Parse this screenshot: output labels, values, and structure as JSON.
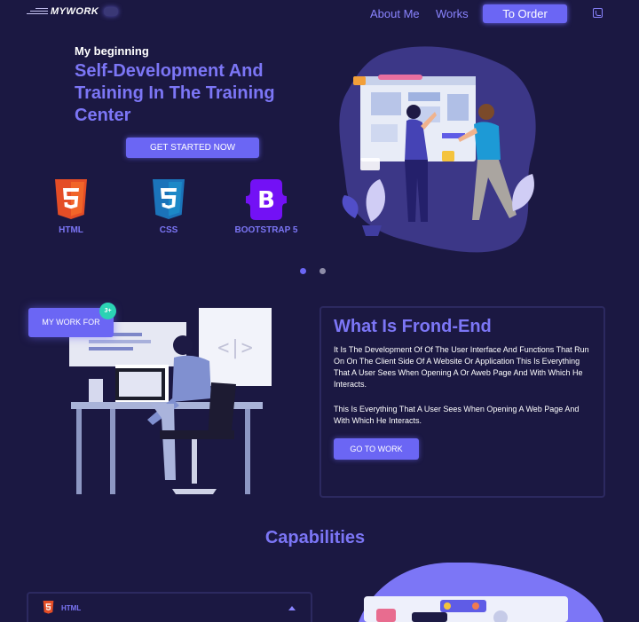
{
  "nav": {
    "logo_text": "MYWORK",
    "links": [
      "About Me",
      "Works"
    ],
    "order_label": "To Order",
    "contact_icon": "phone-icon"
  },
  "hero": {
    "subtitle": "My beginning",
    "title": "Self-Development And Training In The Training Center",
    "cta_label": "GET STARTED NOW",
    "technologies": [
      {
        "label": "HTML",
        "icon": "html5-icon",
        "color": "#e44d26"
      },
      {
        "label": "CSS",
        "icon": "css3-icon",
        "color": "#1b73ba"
      },
      {
        "label": "BOOTSTRAP 5",
        "icon": "bootstrap-icon",
        "color": "#7311f5"
      }
    ],
    "slider_dots": 2,
    "active_dot": 0
  },
  "feature": {
    "tag_label": "MY WORK FOR",
    "tag_badge": "3+",
    "title": "What Is Frond-End",
    "paragraphs": [
      "It Is The Development Of Of The User Interface And Functions That Run On On The Client Side Of A Website Or Application This Is Everything That A User Sees When Opening A Or Aweb Page And With Which He Interacts.",
      "This Is Everything That A User Sees When Opening A Web Page And With Which He Interacts."
    ],
    "button_label": "GO TO WORK"
  },
  "capabilities": {
    "title": "Capabilities",
    "items": [
      {
        "label": "HTML",
        "icon": "html5-icon",
        "expanded": true
      }
    ]
  },
  "colors": {
    "background": "#1b1842",
    "accent": "#6b66f4",
    "accent_text": "#7c76f6",
    "blob": "#3c3787"
  }
}
